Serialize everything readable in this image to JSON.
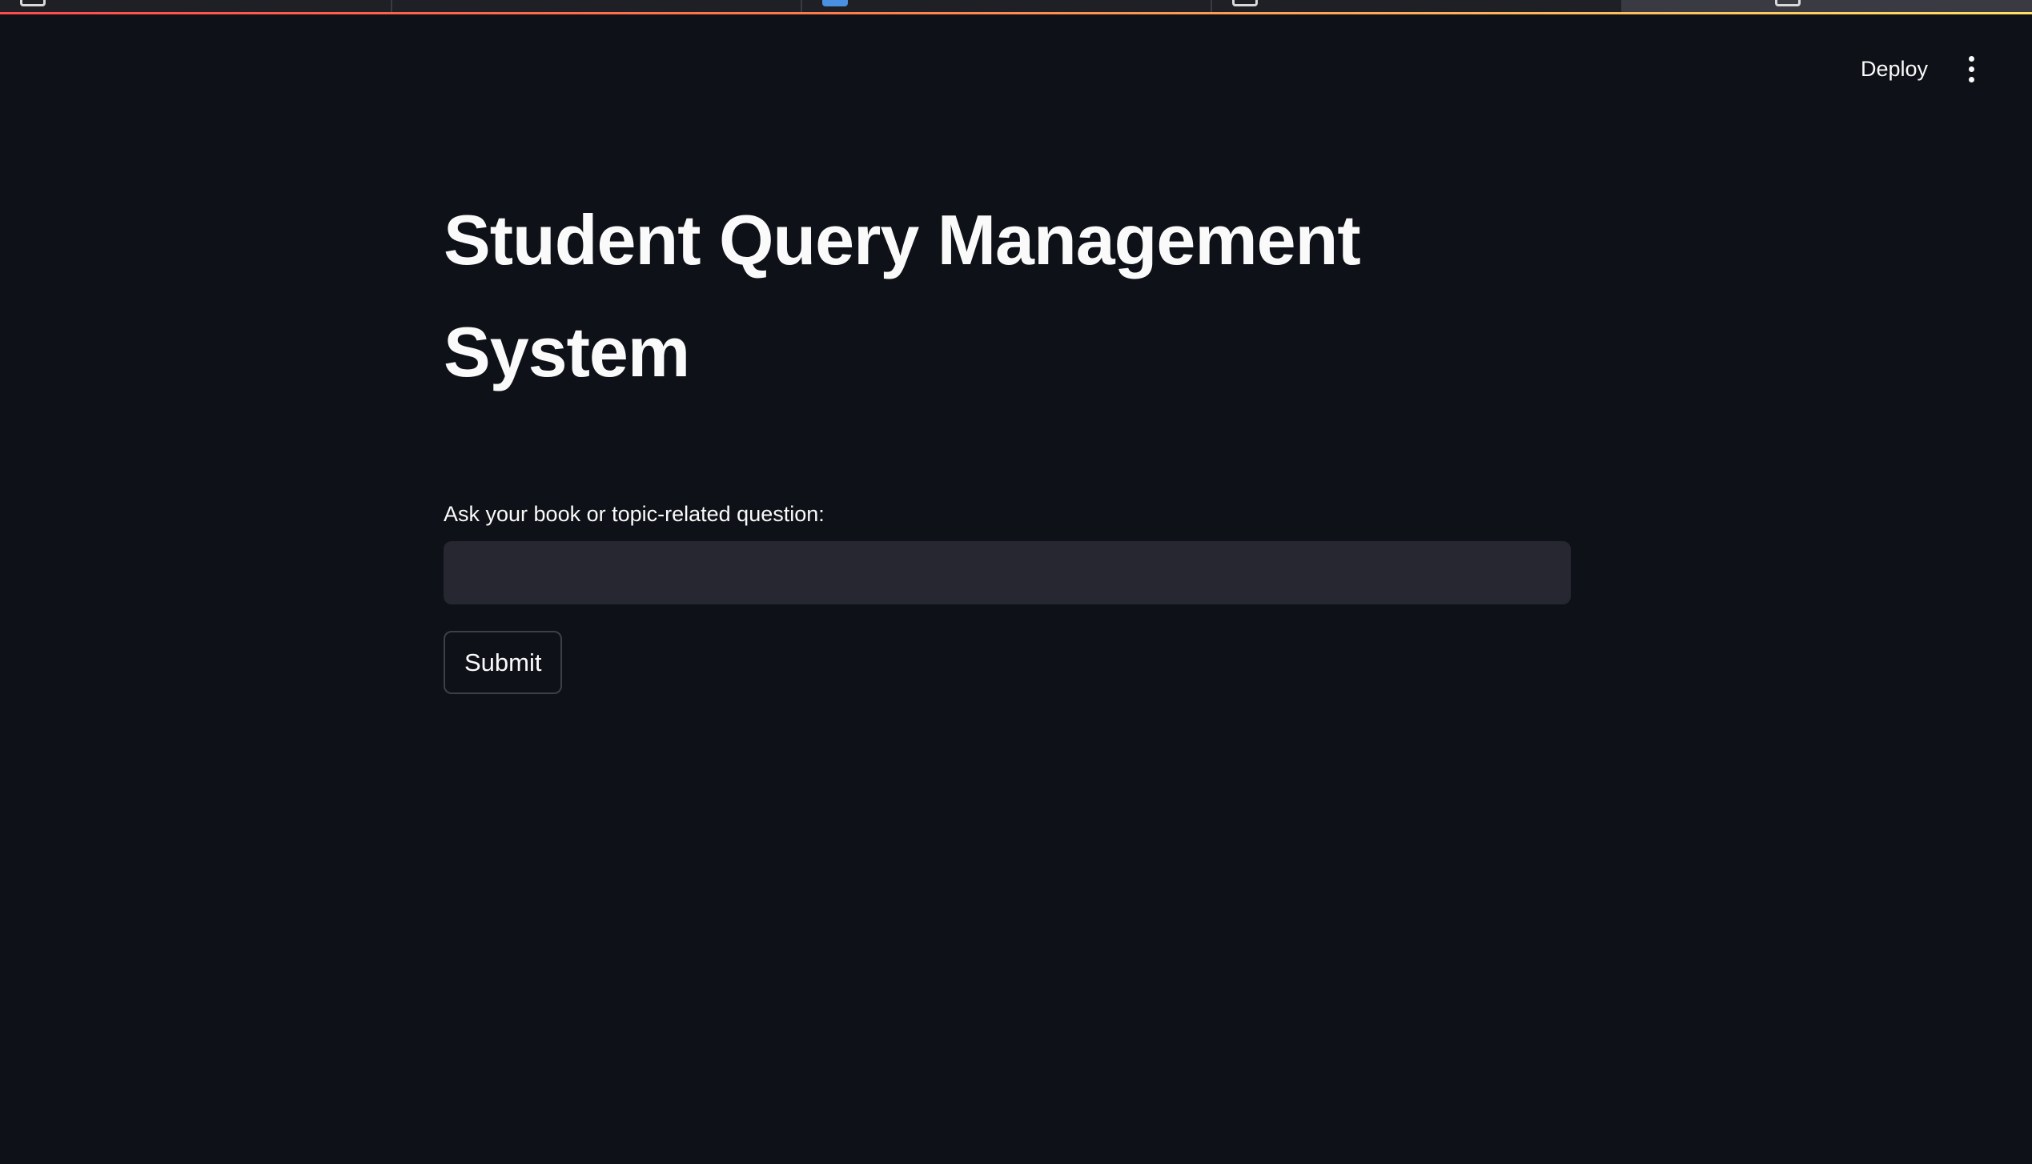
{
  "header": {
    "deploy_label": "Deploy",
    "menu_icon": "vertical-ellipsis-icon"
  },
  "main": {
    "title": "Student Query Management System",
    "question_label": "Ask your book or topic-related question:",
    "question_value": "",
    "submit_label": "Submit"
  },
  "colors": {
    "background": "#0e1117",
    "input_background": "#262730",
    "text": "#fafafa",
    "accent_gradient_start": "#ff4b4b",
    "accent_gradient_end": "#ffe066"
  }
}
